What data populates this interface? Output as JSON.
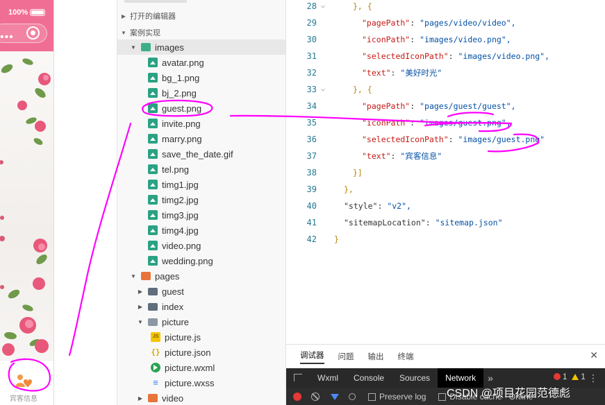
{
  "phone": {
    "battery_percent": "100%",
    "tab_label": "宾客信息"
  },
  "explorer": {
    "section_open_editors": "打开的编辑器",
    "section_project": "案例实现",
    "images_folder": "images",
    "image_files": [
      "avatar.png",
      "bg_1.png",
      "bj_2.png",
      "guest.png",
      "invite.png",
      "marry.png",
      "save_the_date.gif",
      "tel.png",
      "timg1.jpg",
      "timg2.jpg",
      "timg3.jpg",
      "timg4.jpg",
      "video.png",
      "wedding.png"
    ],
    "pages_folder": "pages",
    "page_folders": [
      "guest",
      "index",
      "picture"
    ],
    "picture_files": [
      {
        "name": "picture.js",
        "type": "js"
      },
      {
        "name": "picture.json",
        "type": "json"
      },
      {
        "name": "picture.wxml",
        "type": "wxml"
      },
      {
        "name": "picture.wxss",
        "type": "wxss"
      }
    ],
    "video_folder": "video"
  },
  "editor": {
    "lines": [
      {
        "n": "28",
        "fold": true
      },
      {
        "n": "29",
        "key": "\"pagePath\"",
        "val": "\"pages/video/video\","
      },
      {
        "n": "30",
        "key": "\"iconPath\"",
        "val": "\"images/video.png\","
      },
      {
        "n": "31",
        "key": "\"selectedIconPath\"",
        "val": "\"images/video.png\","
      },
      {
        "n": "32",
        "key": "\"text\"",
        "val": "\"美好时光\""
      },
      {
        "n": "33",
        "fold": true
      },
      {
        "n": "34",
        "key": "\"pagePath\"",
        "val": "\"pages/guest/guest\","
      },
      {
        "n": "35",
        "key": "\"iconPath\"",
        "val": "\"images/guest.png\","
      },
      {
        "n": "36",
        "key": "\"selectedIconPath\"",
        "val": "\"images/guest.png\""
      },
      {
        "n": "37",
        "key": "\"text\"",
        "val": "\"宾客信息\""
      },
      {
        "n": "38"
      },
      {
        "n": "39"
      },
      {
        "n": "40",
        "key": "\"style\"",
        "val": "\"v2\","
      },
      {
        "n": "41",
        "key": "\"sitemapLocation\"",
        "val": "\"sitemap.json\""
      },
      {
        "n": "42"
      }
    ],
    "brace_close_open": "}, {",
    "bracket_close": "}]",
    "brace_close_comma": "},",
    "brace_close": "}",
    "colon": ": "
  },
  "panel": {
    "tabs": [
      "调试器",
      "问题",
      "输出",
      "终端"
    ],
    "devtools_tabs": [
      "Wxml",
      "Console",
      "Sources",
      "Network"
    ],
    "more": "»",
    "errors": "1",
    "warnings": "1",
    "preserve_log": "Preserve log",
    "disable_cache": "Disable cache",
    "online": "Online"
  },
  "watermark": "CSDN @项目花园范德彪",
  "colors": {
    "annotation": "#ff00ff",
    "accent_pink": "#f06e93"
  }
}
